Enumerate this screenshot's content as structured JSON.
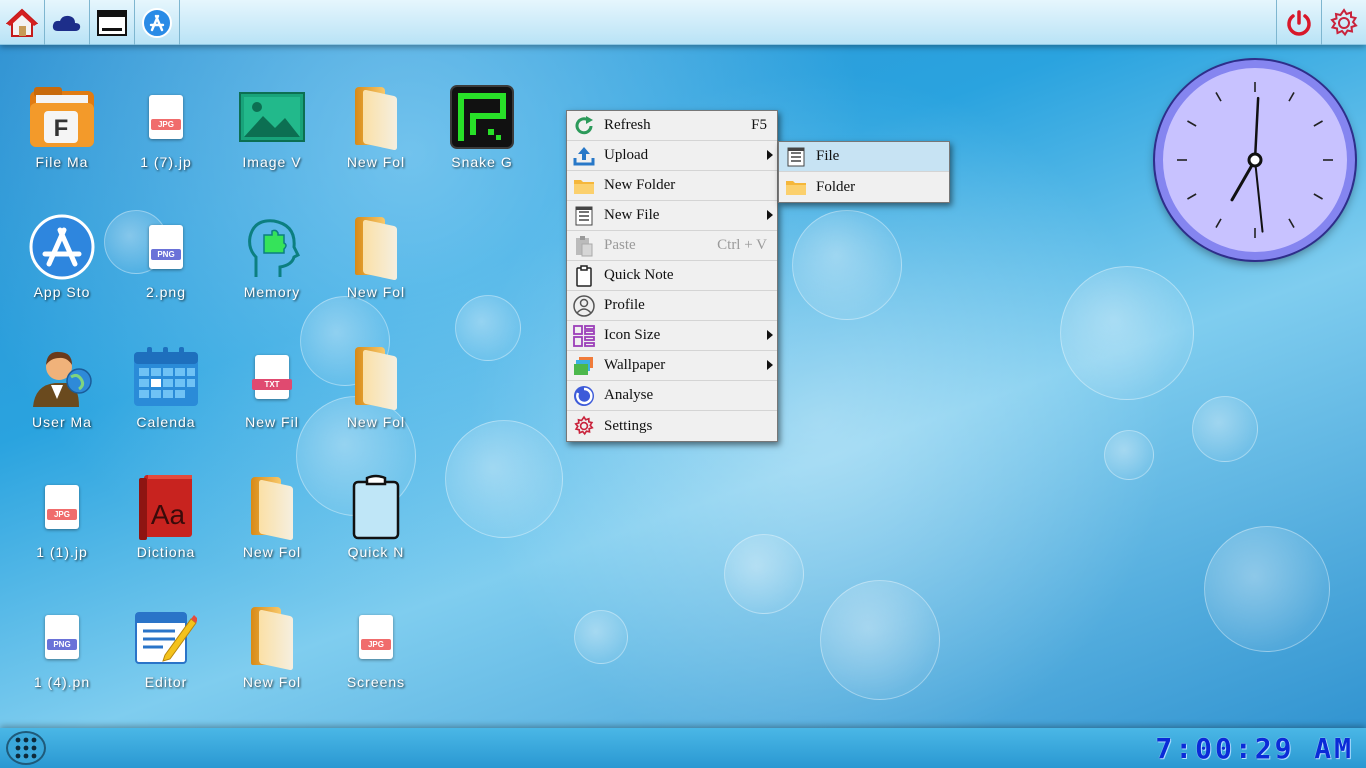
{
  "desktop_icons": [
    {
      "label": "File Ma",
      "icon": "file-manager-icon"
    },
    {
      "label": "1 (7).jp",
      "icon": "jpg-file-icon",
      "tag": "JPG"
    },
    {
      "label": "Image V",
      "icon": "image-viewer-icon"
    },
    {
      "label": "New Fol",
      "icon": "folder-icon"
    },
    {
      "label": "Snake G",
      "icon": "snake-game-icon"
    },
    {
      "label": "App Sto",
      "icon": "app-store-icon"
    },
    {
      "label": "2.png",
      "icon": "png-file-icon",
      "tag": "PNG"
    },
    {
      "label": "Memory",
      "icon": "memory-icon"
    },
    {
      "label": "New Fol",
      "icon": "folder-icon"
    },
    {
      "label": "User Ma",
      "icon": "user-manager-icon"
    },
    {
      "label": "Calenda",
      "icon": "calendar-icon"
    },
    {
      "label": "New Fil",
      "icon": "txt-file-icon",
      "tag": "TXT"
    },
    {
      "label": "New Fol",
      "icon": "folder-icon"
    },
    {
      "label": "1 (1).jp",
      "icon": "jpg-file-icon",
      "tag": "JPG"
    },
    {
      "label": "Dictiona",
      "icon": "dictionary-icon",
      "glyph": "Aa"
    },
    {
      "label": "New Fol",
      "icon": "folder-icon"
    },
    {
      "label": "Quick N",
      "icon": "quick-note-icon"
    },
    {
      "label": "1 (4).pn",
      "icon": "png-file-icon",
      "tag": "PNG"
    },
    {
      "label": "Editor",
      "icon": "editor-icon"
    },
    {
      "label": "New Fol",
      "icon": "folder-icon"
    },
    {
      "label": "Screens",
      "icon": "jpg-file-icon",
      "tag": "JPG"
    }
  ],
  "context_menu": {
    "items": [
      {
        "label": "Refresh",
        "shortcut": "F5",
        "icon": "refresh-icon"
      },
      {
        "label": "Upload",
        "shortcut": "",
        "icon": "upload-icon"
      },
      {
        "label": "New Folder",
        "shortcut": "",
        "icon": "new-folder-icon"
      },
      {
        "label": "New File",
        "shortcut": "",
        "icon": "new-file-icon"
      },
      {
        "label": "Paste",
        "shortcut": "Ctrl + V",
        "icon": "paste-icon"
      },
      {
        "label": "Quick Note",
        "shortcut": "",
        "icon": "quick-note-icon"
      },
      {
        "label": "Profile",
        "shortcut": "",
        "icon": "profile-icon"
      },
      {
        "label": "Icon Size",
        "shortcut": "",
        "icon": "icon-size-icon"
      },
      {
        "label": "Wallpaper",
        "shortcut": "",
        "icon": "wallpaper-icon"
      },
      {
        "label": "Analyse",
        "shortcut": "",
        "icon": "analyse-icon"
      },
      {
        "label": "Settings",
        "shortcut": "",
        "icon": "settings-icon"
      }
    ],
    "disabled": [
      "Paste"
    ]
  },
  "upload_submenu": {
    "items": [
      {
        "label": "File",
        "icon": "file-icon"
      },
      {
        "label": "Folder",
        "icon": "folder-icon"
      }
    ]
  },
  "taskbar": {
    "top_left": [
      "home-icon",
      "cloud-icon",
      "window-icon",
      "app-store-icon"
    ],
    "top_right": [
      "power-icon",
      "gear-icon"
    ]
  },
  "clock": {
    "digital_time": "7:00:29 AM",
    "analog_hour": 7,
    "analog_minute": 0,
    "analog_second": 29
  },
  "colors": {
    "menu_bg": "#f0f0f0",
    "submenu_highlight": "#c7e3f3",
    "clock_face": "#c8c2ff",
    "clock_text": "#0a2bd8",
    "power_red": "#d8182a"
  }
}
